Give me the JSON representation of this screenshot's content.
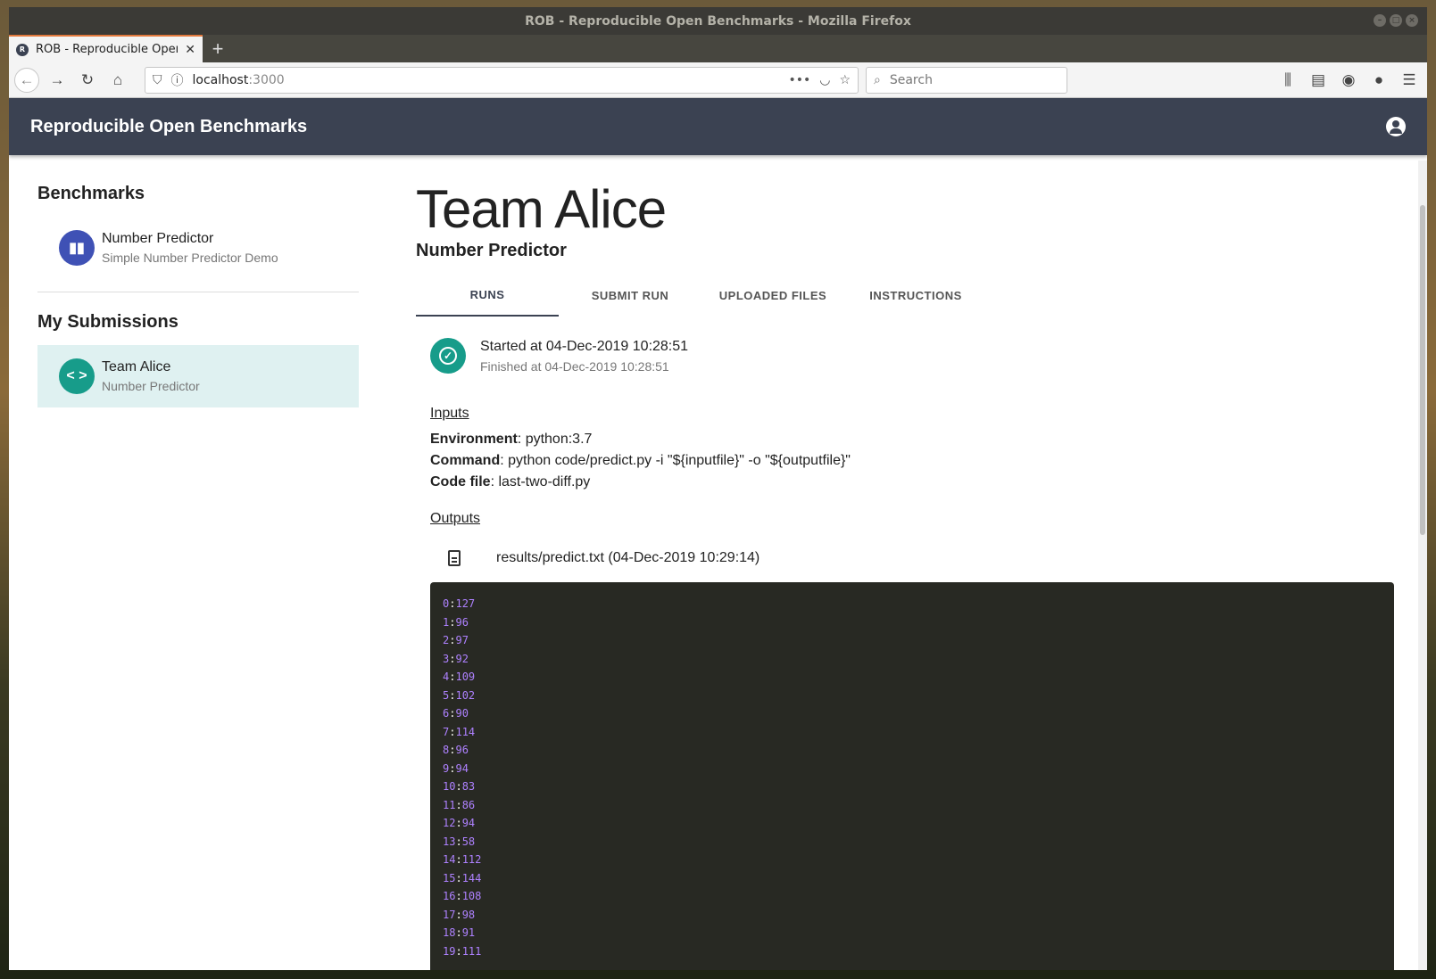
{
  "window": {
    "title": "ROB - Reproducible Open Benchmarks - Mozilla Firefox"
  },
  "browser": {
    "tab_title": "ROB - Reproducible Open Benchmarks",
    "url_host": "localhost",
    "url_port": ":3000",
    "search_placeholder": "Search"
  },
  "app": {
    "title": "Reproducible Open Benchmarks"
  },
  "sidebar": {
    "benchmarks_heading": "Benchmarks",
    "benchmarks": [
      {
        "name": "Number Predictor",
        "description": "Simple Number Predictor Demo"
      }
    ],
    "submissions_heading": "My Submissions",
    "submissions": [
      {
        "name": "Team Alice",
        "benchmark": "Number Predictor"
      }
    ]
  },
  "main": {
    "title": "Team Alice",
    "subtitle": "Number Predictor",
    "tabs": [
      "RUNS",
      "SUBMIT RUN",
      "UPLOADED FILES",
      "INSTRUCTIONS"
    ],
    "run": {
      "started": "Started at 04-Dec-2019 10:28:51",
      "finished": "Finished at 04-Dec-2019 10:28:51"
    },
    "inputs_label": "Inputs",
    "inputs": [
      {
        "key": "Environment",
        "value": ": python:3.7"
      },
      {
        "key": "Command",
        "value": ": python code/predict.py -i \"${inputfile}\" -o \"${outputfile}\""
      },
      {
        "key": "Code file",
        "value": ": last-two-diff.py"
      }
    ],
    "outputs_label": "Outputs",
    "output_file": "results/predict.txt (04-Dec-2019 10:29:14)",
    "output_lines": [
      [
        "0",
        "127"
      ],
      [
        "1",
        "96"
      ],
      [
        "2",
        "97"
      ],
      [
        "3",
        "92"
      ],
      [
        "4",
        "109"
      ],
      [
        "5",
        "102"
      ],
      [
        "6",
        "90"
      ],
      [
        "7",
        "114"
      ],
      [
        "8",
        "96"
      ],
      [
        "9",
        "94"
      ],
      [
        "10",
        "83"
      ],
      [
        "11",
        "86"
      ],
      [
        "12",
        "94"
      ],
      [
        "13",
        "58"
      ],
      [
        "14",
        "112"
      ],
      [
        "15",
        "144"
      ],
      [
        "16",
        "108"
      ],
      [
        "17",
        "98"
      ],
      [
        "18",
        "91"
      ],
      [
        "19",
        "111"
      ]
    ]
  }
}
